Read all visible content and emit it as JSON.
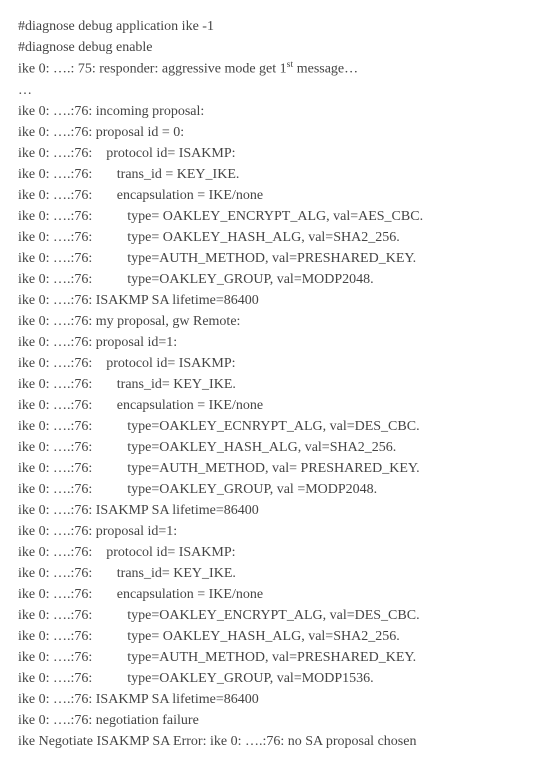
{
  "lines": [
    "#diagnose debug application ike -1",
    "#diagnose debug enable",
    "ike 0: ….: 75: responder: aggressive mode get 1<sup>st</sup> message…",
    "…",
    "ike 0: ….:76: incoming proposal:",
    "ike 0: ….:76: proposal id = 0:",
    "ike 0: ….:76:    protocol id= ISAKMP:",
    "ike 0: ….:76:       trans_id = KEY_IKE.",
    "ike 0: ….:76:       encapsulation = IKE/none",
    "ike 0: ….:76:          type= OAKLEY_ENCRYPT_ALG, val=AES_CBC.",
    "ike 0: ….:76:          type= OAKLEY_HASH_ALG, val=SHA2_256.",
    "ike 0: ….:76:          type=AUTH_METHOD, val=PRESHARED_KEY.",
    "ike 0: ….:76:          type=OAKLEY_GROUP, val=MODP2048.",
    "ike 0: ….:76: ISAKMP SA lifetime=86400",
    "ike 0: ….:76: my proposal, gw Remote:",
    "ike 0: ….:76: proposal id=1:",
    "ike 0: ….:76:    protocol id= ISAKMP:",
    "ike 0: ….:76:       trans_id= KEY_IKE.",
    "ike 0: ….:76:       encapsulation = IKE/none",
    "ike 0: ….:76:          type=OAKLEY_ECNRYPT_ALG, val=DES_CBC.",
    "ike 0: ….:76:          type=OAKLEY_HASH_ALG, val=SHA2_256.",
    "ike 0: ….:76:          type=AUTH_METHOD, val= PRESHARED_KEY.",
    "ike 0: ….:76:          type=OAKLEY_GROUP, val =MODP2048.",
    "ike 0: ….:76: ISAKMP SA lifetime=86400",
    "ike 0: ….:76: proposal id=1:",
    "ike 0: ….:76:    protocol id= ISAKMP:",
    "ike 0: ….:76:       trans_id= KEY_IKE.",
    "ike 0: ….:76:       encapsulation = IKE/none",
    "ike 0: ….:76:          type=OAKLEY_ENCRYPT_ALG, val=DES_CBC.",
    "ike 0: ….:76:          type= OAKLEY_HASH_ALG, val=SHA2_256.",
    "ike 0: ….:76:          type=AUTH_METHOD, val=PRESHARED_KEY.",
    "ike 0: ….:76:          type=OAKLEY_GROUP, val=MODP1536.",
    "ike 0: ….:76: ISAKMP SA lifetime=86400",
    "ike 0: ….:76: negotiation failure",
    "ike Negotiate ISAKMP SA Error: ike 0: ….:76: no SA proposal chosen"
  ]
}
